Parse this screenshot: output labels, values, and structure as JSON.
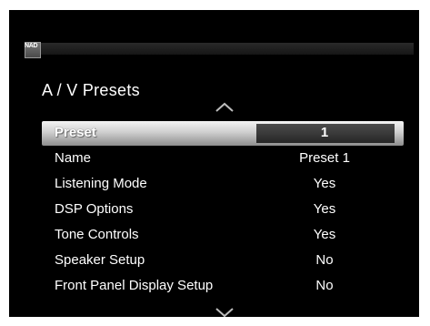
{
  "brand": "NAD",
  "page_title": "A / V Presets",
  "menu": {
    "items": [
      {
        "label": "Preset",
        "value": "1"
      },
      {
        "label": "Name",
        "value": "Preset 1"
      },
      {
        "label": "Listening Mode",
        "value": "Yes"
      },
      {
        "label": "DSP Options",
        "value": "Yes"
      },
      {
        "label": "Tone Controls",
        "value": "Yes"
      },
      {
        "label": "Speaker Setup",
        "value": "No"
      },
      {
        "label": "Front Panel Display Setup",
        "value": "No"
      }
    ]
  },
  "colors": {
    "background": "#000000",
    "text": "#ffffff",
    "highlight": "#d9d9d9"
  },
  "icons": {
    "scroll_up": "chevron-up-icon",
    "scroll_down": "chevron-down-icon"
  }
}
